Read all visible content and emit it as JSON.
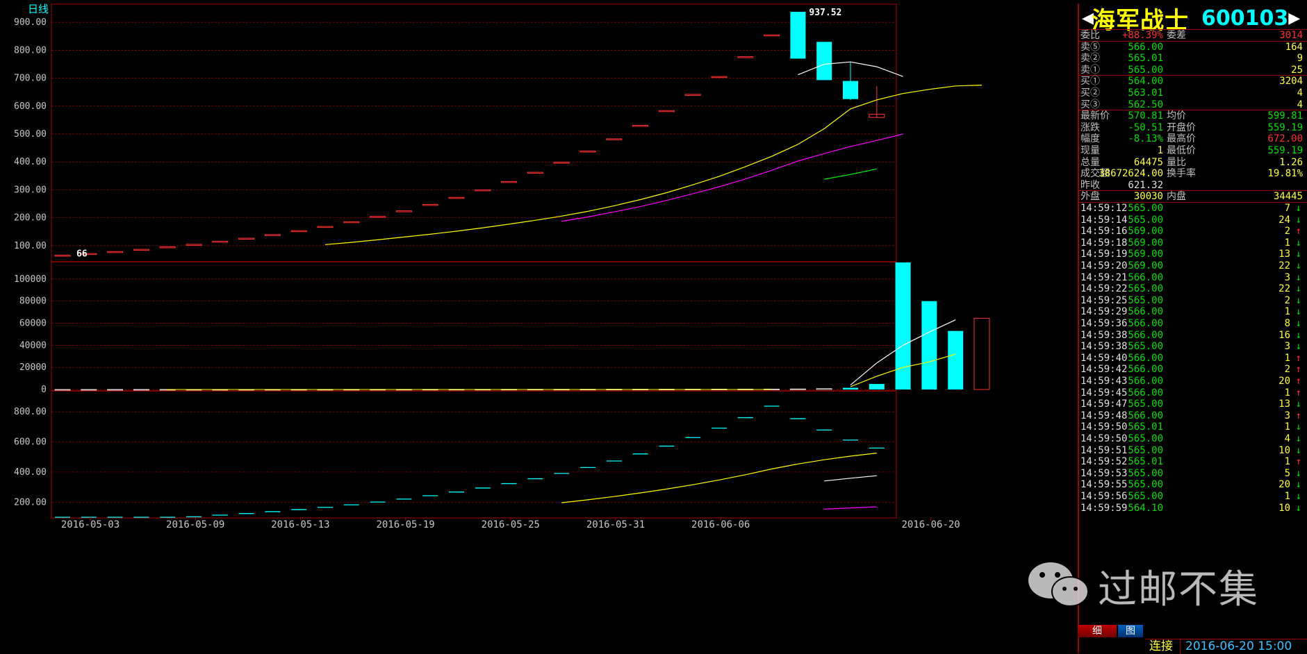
{
  "period_label": "日线",
  "stock": {
    "name": "海军战士",
    "code": "600103",
    "arrow_left": "◀",
    "arrow_right": "▶"
  },
  "colors": {
    "grid": "#a00000",
    "bar_up": "#ff3030",
    "bar_down": "#00ffff",
    "ma5": "#ffffff",
    "ma10": "#ffff00",
    "ma20": "#ff00ff",
    "ma60": "#00ff00"
  },
  "chart_data": [
    {
      "type": "candlestick",
      "title": "",
      "ylim": [
        50,
        960
      ],
      "y_ticks": [
        "100.00",
        "200.00",
        "300.00",
        "400.00",
        "500.00",
        "600.00",
        "700.00",
        "800.00",
        "900.00"
      ],
      "annotations": [
        {
          "text": "66"
        },
        {
          "text": "937.52"
        }
      ],
      "candles": [
        {
          "o": 66,
          "h": 66,
          "l": 66,
          "c": 66
        },
        {
          "o": 72,
          "h": 72,
          "l": 72,
          "c": 72
        },
        {
          "o": 79,
          "h": 79,
          "l": 79,
          "c": 79
        },
        {
          "o": 87,
          "h": 87,
          "l": 87,
          "c": 87
        },
        {
          "o": 96,
          "h": 96,
          "l": 96,
          "c": 96
        },
        {
          "o": 105,
          "h": 105,
          "l": 105,
          "c": 105
        },
        {
          "o": 116,
          "h": 116,
          "l": 116,
          "c": 116
        },
        {
          "o": 127,
          "h": 127,
          "l": 127,
          "c": 127
        },
        {
          "o": 140,
          "h": 140,
          "l": 140,
          "c": 140
        },
        {
          "o": 154,
          "h": 154,
          "l": 154,
          "c": 154
        },
        {
          "o": 169,
          "h": 169,
          "l": 169,
          "c": 169
        },
        {
          "o": 186,
          "h": 186,
          "l": 186,
          "c": 186
        },
        {
          "o": 205,
          "h": 205,
          "l": 205,
          "c": 205
        },
        {
          "o": 225,
          "h": 225,
          "l": 225,
          "c": 225
        },
        {
          "o": 248,
          "h": 248,
          "l": 248,
          "c": 248
        },
        {
          "o": 273,
          "h": 273,
          "l": 273,
          "c": 273
        },
        {
          "o": 300,
          "h": 300,
          "l": 300,
          "c": 300
        },
        {
          "o": 330,
          "h": 330,
          "l": 330,
          "c": 330
        },
        {
          "o": 363,
          "h": 363,
          "l": 363,
          "c": 363
        },
        {
          "o": 399,
          "h": 399,
          "l": 399,
          "c": 399
        },
        {
          "o": 439,
          "h": 439,
          "l": 439,
          "c": 439
        },
        {
          "o": 483,
          "h": 483,
          "l": 483,
          "c": 483
        },
        {
          "o": 531,
          "h": 531,
          "l": 531,
          "c": 531
        },
        {
          "o": 584,
          "h": 584,
          "l": 584,
          "c": 584
        },
        {
          "o": 642,
          "h": 642,
          "l": 642,
          "c": 642
        },
        {
          "o": 706,
          "h": 706,
          "l": 706,
          "c": 706
        },
        {
          "o": 777,
          "h": 777,
          "l": 777,
          "c": 777
        },
        {
          "o": 855,
          "h": 855,
          "l": 855,
          "c": 855
        },
        {
          "o": 937.52,
          "h": 937.52,
          "l": 770,
          "c": 770
        },
        {
          "o": 830,
          "h": 830,
          "l": 693,
          "c": 693
        },
        {
          "o": 690,
          "h": 760,
          "l": 621,
          "c": 625
        },
        {
          "o": 559.19,
          "h": 672,
          "l": 559.19,
          "c": 570.81
        }
      ],
      "ma5": [
        null,
        null,
        null,
        null,
        null,
        null,
        null,
        null,
        null,
        null,
        null,
        null,
        null,
        null,
        null,
        null,
        null,
        null,
        null,
        null,
        null,
        null,
        null,
        null,
        null,
        null,
        null,
        null,
        712,
        750,
        758,
        741,
        706
      ],
      "ma10": [
        null,
        null,
        null,
        null,
        null,
        null,
        null,
        null,
        null,
        null,
        104,
        112,
        121,
        131,
        141,
        152,
        164,
        177,
        191,
        206,
        223,
        243,
        265,
        290,
        318,
        348,
        383,
        420,
        463,
        519,
        590,
        622,
        645,
        660,
        672,
        675
      ],
      "ma20": [
        null,
        null,
        null,
        null,
        null,
        null,
        null,
        null,
        null,
        null,
        null,
        null,
        null,
        null,
        null,
        null,
        null,
        null,
        null,
        187,
        203,
        221,
        240,
        262,
        286,
        311,
        339,
        370,
        403,
        430,
        455,
        477,
        500
      ],
      "ma60": [
        null,
        null,
        null,
        null,
        null,
        null,
        null,
        null,
        null,
        null,
        null,
        null,
        null,
        null,
        null,
        null,
        null,
        null,
        null,
        null,
        null,
        null,
        null,
        null,
        null,
        null,
        null,
        null,
        null,
        338,
        355,
        375
      ]
    },
    {
      "type": "bar",
      "title": "",
      "ylim": [
        0,
        115000
      ],
      "y_ticks": [
        "0",
        "20000",
        "40000",
        "60000",
        "80000",
        "100000"
      ],
      "values": [
        10,
        20,
        30,
        40,
        50,
        60,
        70,
        80,
        90,
        100,
        110,
        120,
        130,
        140,
        150,
        160,
        170,
        180,
        190,
        200,
        220,
        240,
        260,
        280,
        300,
        330,
        360,
        400,
        500,
        800,
        1500,
        5000,
        115000,
        80000,
        53000,
        64475
      ],
      "ma5": [
        null,
        null,
        null,
        null,
        null,
        null,
        null,
        null,
        null,
        null,
        null,
        null,
        null,
        null,
        null,
        null,
        null,
        null,
        null,
        null,
        null,
        null,
        null,
        null,
        null,
        null,
        null,
        null,
        null,
        null,
        4000,
        24000,
        40000,
        52000,
        63000
      ],
      "ma10": [
        null,
        null,
        null,
        null,
        null,
        null,
        null,
        null,
        null,
        null,
        null,
        null,
        null,
        null,
        null,
        null,
        null,
        null,
        null,
        null,
        null,
        null,
        null,
        null,
        null,
        null,
        null,
        null,
        null,
        null,
        2500,
        12000,
        20000,
        25000,
        32000
      ]
    },
    {
      "type": "line",
      "title": "",
      "ylim": [
        100,
        930
      ],
      "y_ticks": [
        "200.00",
        "400.00",
        "600.00",
        "800.00"
      ]
    }
  ],
  "x_ticks": [
    "2016-05-03",
    "2016-05-09",
    "2016-05-13",
    "2016-05-19",
    "2016-05-25",
    "2016-05-31",
    "2016-06-06",
    "2016-06-20"
  ],
  "quote": {
    "weibi": {
      "label": "委比",
      "value": "+88.39%",
      "label2": "委差",
      "value2": "3014"
    },
    "asks": [
      {
        "label": "卖⑤",
        "price": "566.00",
        "vol": "164"
      },
      {
        "label": "卖②",
        "price": "565.01",
        "vol": "9"
      },
      {
        "label": "卖①",
        "price": "565.00",
        "vol": "25"
      }
    ],
    "bids": [
      {
        "label": "买①",
        "price": "564.00",
        "vol": "3204"
      },
      {
        "label": "买②",
        "price": "563.01",
        "vol": "4"
      },
      {
        "label": "买③",
        "price": "562.50",
        "vol": "4"
      }
    ],
    "stats": [
      {
        "l1": "最新价",
        "v1": "570.81",
        "l2": "均价",
        "v2": "599.81"
      },
      {
        "l1": "涨跌",
        "v1": "-50.51",
        "l2": "开盘价",
        "v2": "559.19"
      },
      {
        "l1": "幅度",
        "v1": "-8.13%",
        "l2": "最高价",
        "v2": "672.00"
      },
      {
        "l1": "现量",
        "v1": "1",
        "l2": "最低价",
        "v2": "559.19"
      },
      {
        "l1": "总量",
        "v1": "64475",
        "l2": "量比",
        "v2": "1.26"
      },
      {
        "l1": "成交额",
        "v1": "38672624.00",
        "l2": "换手率",
        "v2": "19.81%"
      },
      {
        "l1": "昨收",
        "v1": "621.32",
        "l2": "",
        "v2": ""
      }
    ],
    "outer": {
      "label": "外盘",
      "value": "30030",
      "label2": "内盘",
      "value2": "34445"
    }
  },
  "ticks": [
    {
      "time": "14:59:12",
      "price": "565.00",
      "vol": "7",
      "dir": "↓"
    },
    {
      "time": "14:59:14",
      "price": "565.00",
      "vol": "24",
      "dir": "↓"
    },
    {
      "time": "14:59:16",
      "price": "569.00",
      "vol": "2",
      "dir": "↑"
    },
    {
      "time": "14:59:18",
      "price": "569.00",
      "vol": "1",
      "dir": "↓"
    },
    {
      "time": "14:59:19",
      "price": "569.00",
      "vol": "13",
      "dir": "↓"
    },
    {
      "time": "14:59:20",
      "price": "569.00",
      "vol": "22",
      "dir": "↓"
    },
    {
      "time": "14:59:21",
      "price": "566.00",
      "vol": "3",
      "dir": "↓"
    },
    {
      "time": "14:59:22",
      "price": "565.00",
      "vol": "22",
      "dir": "↓"
    },
    {
      "time": "14:59:25",
      "price": "565.00",
      "vol": "2",
      "dir": "↓"
    },
    {
      "time": "14:59:29",
      "price": "566.00",
      "vol": "1",
      "dir": "↓"
    },
    {
      "time": "14:59:36",
      "price": "566.00",
      "vol": "8",
      "dir": "↓"
    },
    {
      "time": "14:59:38",
      "price": "566.00",
      "vol": "16",
      "dir": "↓"
    },
    {
      "time": "14:59:38",
      "price": "565.00",
      "vol": "3",
      "dir": "↓"
    },
    {
      "time": "14:59:40",
      "price": "566.00",
      "vol": "1",
      "dir": "↑"
    },
    {
      "time": "14:59:42",
      "price": "566.00",
      "vol": "2",
      "dir": "↑"
    },
    {
      "time": "14:59:43",
      "price": "566.00",
      "vol": "20",
      "dir": "↑"
    },
    {
      "time": "14:59:45",
      "price": "566.00",
      "vol": "1",
      "dir": "↑"
    },
    {
      "time": "14:59:47",
      "price": "565.00",
      "vol": "13",
      "dir": "↓"
    },
    {
      "time": "14:59:48",
      "price": "566.00",
      "vol": "3",
      "dir": "↑"
    },
    {
      "time": "14:59:50",
      "price": "565.01",
      "vol": "1",
      "dir": "↓"
    },
    {
      "time": "14:59:50",
      "price": "565.00",
      "vol": "4",
      "dir": "↓"
    },
    {
      "time": "14:59:51",
      "price": "565.00",
      "vol": "10",
      "dir": "↓"
    },
    {
      "time": "14:59:52",
      "price": "565.01",
      "vol": "1",
      "dir": "↑"
    },
    {
      "time": "14:59:53",
      "price": "565.00",
      "vol": "5",
      "dir": "↓"
    },
    {
      "time": "14:59:55",
      "price": "565.00",
      "vol": "20",
      "dir": "↓"
    },
    {
      "time": "14:59:56",
      "price": "565.00",
      "vol": "1",
      "dir": "↓"
    },
    {
      "time": "14:59:59",
      "price": "564.10",
      "vol": "10",
      "dir": "↓"
    }
  ],
  "tabs": [
    "细",
    "图"
  ],
  "status": {
    "conn": "连接",
    "datetime": "2016-06-20 15:00"
  },
  "watermark": "过邮不集"
}
